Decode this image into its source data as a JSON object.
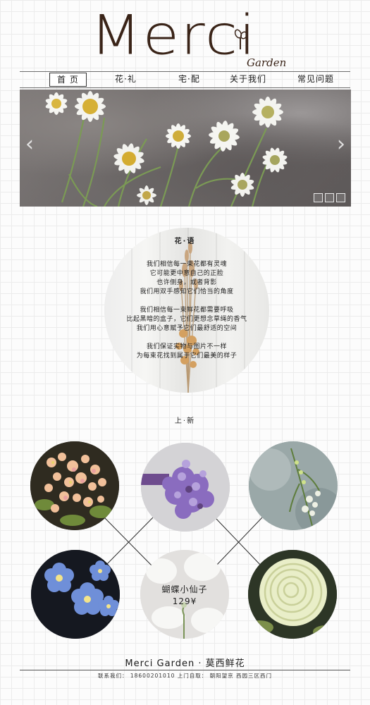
{
  "logo": {
    "word": "Merci",
    "sub": "Garden"
  },
  "nav": {
    "items": [
      {
        "label": "首 页",
        "active": true
      },
      {
        "label": "花·礼"
      },
      {
        "label": "宅·配"
      },
      {
        "label": "关于我们"
      },
      {
        "label": "常见问题"
      }
    ]
  },
  "banner": {
    "prev_icon": "chevron-left-icon",
    "next_icon": "chevron-right-icon",
    "slide_count": 3
  },
  "flower_language": {
    "title": "花·语",
    "lines": [
      "我们相信每一束花都有灵魂",
      "它可能更中意自己的正脸",
      "也许侧身，或者背影",
      "我们用双手感知它们恰当的角度",
      "",
      "我们相信每一束鲜花都需要呼吸",
      "比起黑暗的盒子，它们更想念草绳的香气",
      "我们用心意赋予它们最舒适的空间",
      "",
      "我们保证实物与图片不一样",
      "为每束花找到属于它们最美的样子"
    ]
  },
  "new_arrivals": {
    "title": "上·新",
    "product": {
      "name": "蝴蝶小仙子",
      "price": "129¥"
    }
  },
  "footer": {
    "title": "Merci Garden · 莫西鲜花",
    "info": "联系我们： 18600201010  上门自取： 朝阳望京 西园三区西门"
  },
  "colors": {
    "logo": "#3a2418",
    "text": "#2b2420",
    "grid": "#ececec"
  }
}
